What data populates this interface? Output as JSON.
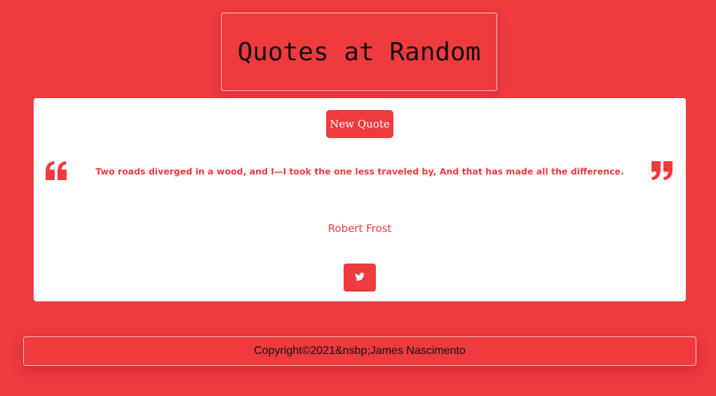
{
  "header": {
    "title": "Quotes at Random"
  },
  "quote_card": {
    "new_quote_label": "New Quote",
    "text": "Two roads diverged in a wood, and I—I took the one less traveled by, And that has made all the difference.",
    "author": "Robert Frost",
    "open_quote_icon": "quote-left-icon",
    "close_quote_icon": "quote-right-icon",
    "tweet_icon": "twitter-icon"
  },
  "footer": {
    "copyright": "Copyright©2021&nsbp;James Nascimento"
  },
  "colors": {
    "accent": "#ef3a3e",
    "card_background": "#ffffff"
  }
}
